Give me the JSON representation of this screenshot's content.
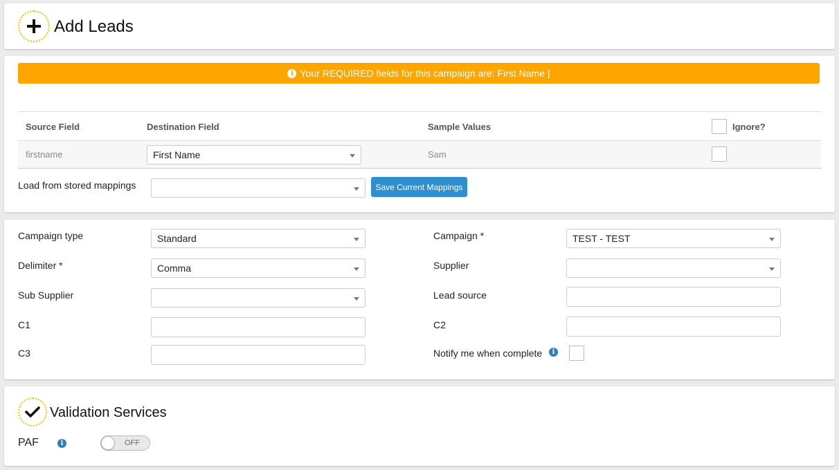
{
  "header": {
    "title": "Add Leads",
    "icon": "plus-icon"
  },
  "alert": {
    "text": "Your REQUIRED fields for this campaign are: First Name |",
    "color": "#ffa500"
  },
  "mapping": {
    "columns": {
      "source": "Source Field",
      "destination": "Destination Field",
      "sample": "Sample Values",
      "ignore": "Ignore?"
    },
    "rows": [
      {
        "source": "firstname",
        "destination": "First Name",
        "sample": "Sam",
        "ignore": false
      }
    ],
    "stored_label": "Load from stored mappings",
    "stored_value": "",
    "save_button": "Save Current Mappings"
  },
  "form": {
    "campaign_type": {
      "label": "Campaign type",
      "value": "Standard"
    },
    "delimiter": {
      "label": "Delimiter *",
      "value": "Comma"
    },
    "sub_supplier": {
      "label": "Sub Supplier",
      "value": ""
    },
    "c1": {
      "label": "C1",
      "value": ""
    },
    "c3": {
      "label": "C3",
      "value": ""
    },
    "campaign": {
      "label": "Campaign *",
      "value": "TEST - TEST"
    },
    "supplier": {
      "label": "Supplier",
      "value": ""
    },
    "lead_source": {
      "label": "Lead source",
      "value": ""
    },
    "c2": {
      "label": "C2",
      "value": ""
    },
    "notify": {
      "label": "Notify me when complete",
      "checked": false
    }
  },
  "validation": {
    "title": "Validation Services",
    "icon": "checkmark-icon",
    "paf": {
      "label": "PAF",
      "state": "OFF"
    }
  }
}
